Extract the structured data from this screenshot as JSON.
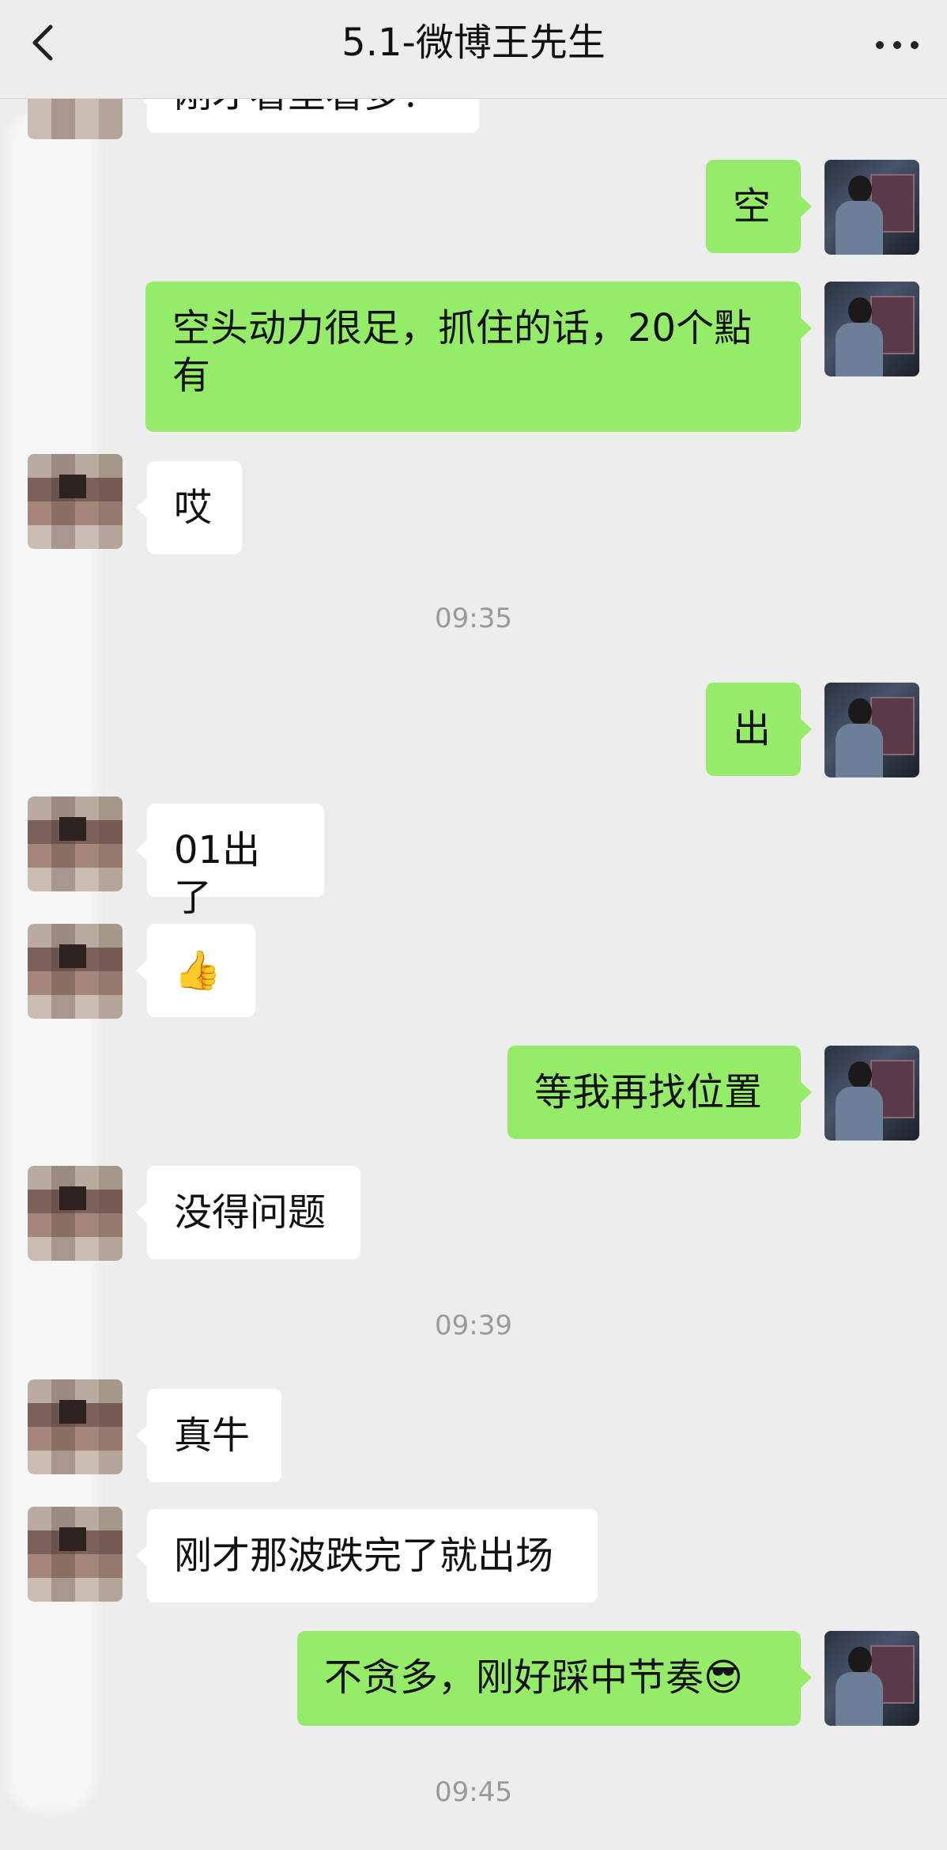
{
  "header": {
    "title": "5.1-微博王先生"
  },
  "messages": [
    {
      "side": "in",
      "text": "刚才看里看多？"
    },
    {
      "side": "out",
      "text": "空"
    },
    {
      "side": "out",
      "text": "空头动力很足，抓住的话，20个點有"
    },
    {
      "side": "in",
      "text": "哎"
    },
    {
      "side": "out",
      "text": "出"
    },
    {
      "side": "in",
      "text": "01出了"
    },
    {
      "side": "in",
      "text": "👍"
    },
    {
      "side": "out",
      "text": "等我再找位置"
    },
    {
      "side": "in",
      "text": "没得问题"
    },
    {
      "side": "in",
      "text": "真牛"
    },
    {
      "side": "in",
      "text": "刚才那波跌完了就出场"
    },
    {
      "side": "out",
      "text": "不贪多，刚好踩中节奏😎"
    }
  ],
  "timestamps": [
    "09:35",
    "09:39",
    "09:45"
  ],
  "colors": {
    "out_bubble": "#95ec69",
    "in_bubble": "#ffffff",
    "background": "#ededed"
  },
  "icons": {
    "back": "chevron-left-icon",
    "more": "more-dots-icon"
  }
}
